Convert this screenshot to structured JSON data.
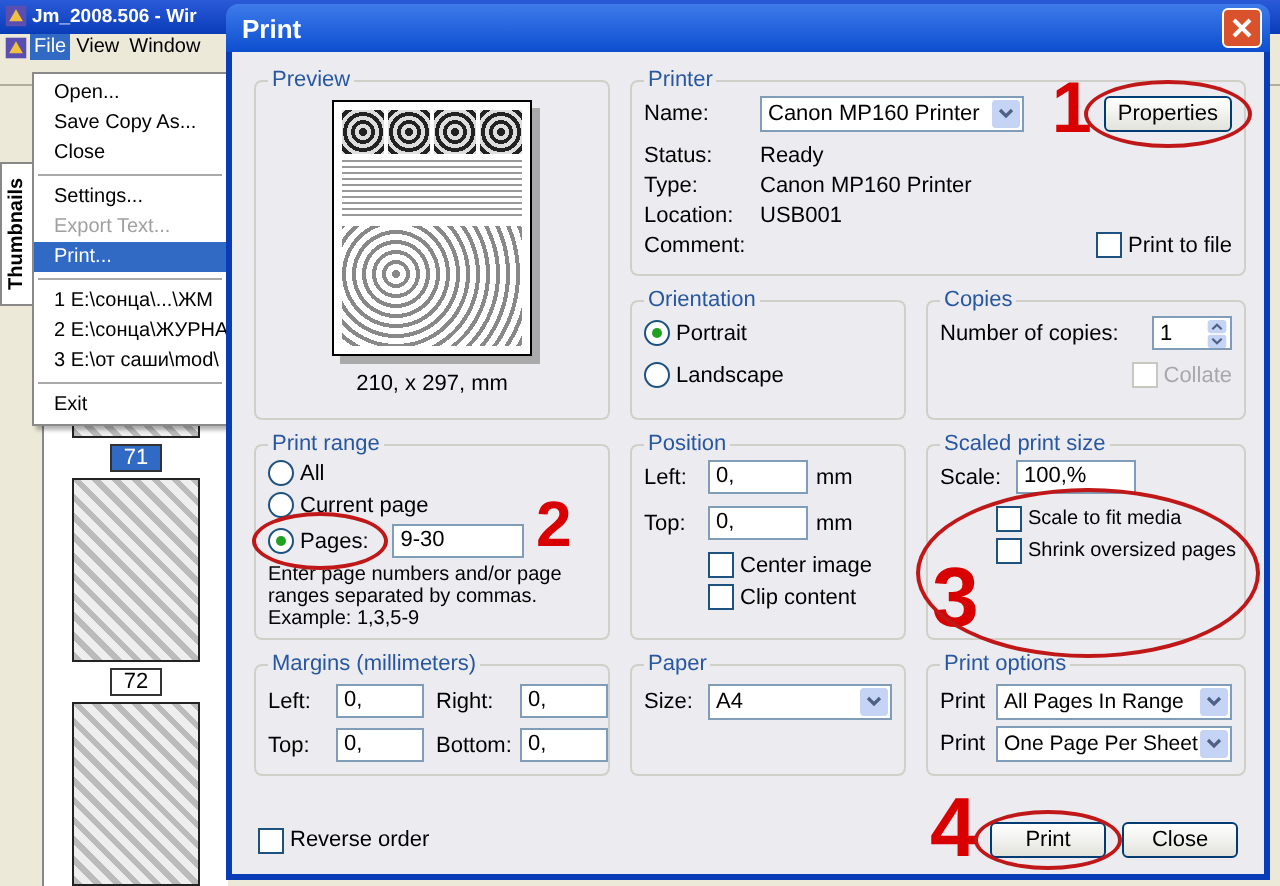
{
  "app": {
    "title": "Jm_2008.506 - Wir",
    "menu": [
      {
        "label": "File",
        "selected": true
      },
      {
        "label": "View",
        "selected": false
      },
      {
        "label": "Window",
        "selected": false
      }
    ],
    "file_menu": [
      {
        "kind": "item",
        "label": "Open...",
        "disabled": false,
        "selected": false
      },
      {
        "kind": "item",
        "label": "Save Copy As...",
        "disabled": false,
        "selected": false
      },
      {
        "kind": "item",
        "label": "Close",
        "disabled": false,
        "selected": false
      },
      {
        "kind": "separator"
      },
      {
        "kind": "item",
        "label": "Settings...",
        "disabled": false,
        "selected": false
      },
      {
        "kind": "item",
        "label": "Export Text...",
        "disabled": true,
        "selected": false
      },
      {
        "kind": "item",
        "label": "Print...",
        "disabled": false,
        "selected": true
      },
      {
        "kind": "separator"
      },
      {
        "kind": "item",
        "label": "1 E:\\сонца\\...\\ЖМ",
        "disabled": false,
        "selected": false
      },
      {
        "kind": "item",
        "label": "2 E:\\сонца\\ЖУРНА",
        "disabled": false,
        "selected": false
      },
      {
        "kind": "item",
        "label": "3 E:\\от саши\\mod\\",
        "disabled": false,
        "selected": false
      },
      {
        "kind": "separator"
      },
      {
        "kind": "item",
        "label": "Exit",
        "disabled": false,
        "selected": false
      }
    ],
    "side_tab": "Thumbnails",
    "thumbnails": [
      {
        "label": "71",
        "selected": true
      },
      {
        "label": "72",
        "selected": false
      },
      {
        "selected": false
      }
    ]
  },
  "dialog": {
    "title": "Print",
    "preview": {
      "title": "Preview",
      "caption": "210, x 297, mm"
    },
    "printer": {
      "title": "Printer",
      "name_label": "Name:",
      "name": "Canon MP160 Printer",
      "properties": "Properties",
      "callout": "1",
      "info": [
        {
          "label": "Status:",
          "value": "Ready"
        },
        {
          "label": "Type:",
          "value": "Canon MP160 Printer"
        },
        {
          "label": "Location:",
          "value": "USB001"
        },
        {
          "label": "Comment:"
        }
      ],
      "print_to_file": {
        "label": "Print to file",
        "checked": false
      }
    },
    "orientation": {
      "title": "Orientation",
      "options": [
        {
          "label": "Portrait",
          "selected": true
        },
        {
          "label": "Landscape",
          "selected": false
        }
      ]
    },
    "copies": {
      "title": "Copies",
      "label": "Number of copies:",
      "value": "1",
      "collate": {
        "label": "Collate",
        "checked": false,
        "disabled": true
      }
    },
    "print_range": {
      "title": "Print range",
      "options": [
        {
          "label": "All",
          "selected": false
        },
        {
          "label": "Current page",
          "selected": false
        },
        {
          "label": "Pages:",
          "selected": true,
          "value": "9-30"
        }
      ],
      "hint": "Enter page numbers and/or page ranges separated by commas. Example: 1,3,5-9",
      "callout": "2"
    },
    "position": {
      "title": "Position",
      "fields": [
        {
          "label": "Left:",
          "value": "0,",
          "unit": "mm"
        },
        {
          "label": "Top:",
          "value": "0,",
          "unit": "mm"
        }
      ],
      "checks": [
        {
          "label": "Center image",
          "checked": false
        },
        {
          "label": "Clip content",
          "checked": false
        }
      ]
    },
    "scaled": {
      "title": "Scaled print size",
      "scale_label": "Scale:",
      "scale": "100,%",
      "checks": [
        {
          "label": "Scale to fit media",
          "checked": false
        },
        {
          "label": "Shrink oversized pages",
          "checked": false
        }
      ],
      "callout": "3"
    },
    "margins": {
      "title": "Margins (millimeters)",
      "fields": [
        {
          "label": "Left:",
          "value": "0,"
        },
        {
          "label": "Right:",
          "value": "0,"
        },
        {
          "label": "Top:",
          "value": "0,"
        },
        {
          "label": "Bottom:",
          "value": "0,"
        }
      ]
    },
    "paper": {
      "title": "Paper",
      "size_label": "Size:",
      "size": "A4"
    },
    "print_options": {
      "title": "Print options",
      "rows": [
        {
          "label": "Print",
          "value": "All Pages In Range"
        },
        {
          "label": "Print",
          "value": "One Page Per Sheet"
        }
      ]
    },
    "reverse_order": {
      "label": "Reverse order",
      "checked": false
    },
    "buttons": [
      {
        "label": "Print",
        "callout": "4"
      },
      {
        "label": "Close"
      }
    ]
  }
}
